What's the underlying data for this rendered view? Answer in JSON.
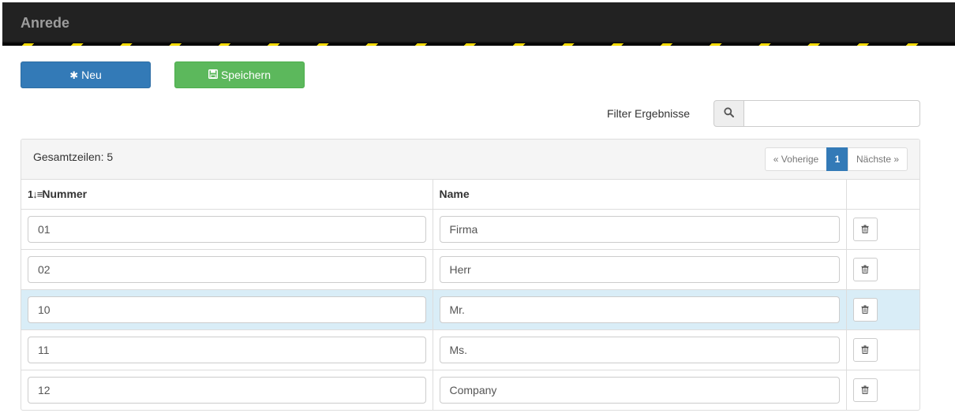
{
  "header": {
    "title": "Anrede"
  },
  "toolbar": {
    "new_label": "Neu",
    "save_label": "Speichern"
  },
  "filter": {
    "label": "Filter Ergebnisse",
    "value": "",
    "placeholder": ""
  },
  "panel": {
    "total_label": "Gesamtzeilen: 5",
    "pagination": {
      "prev": "« Voherige",
      "current": "1",
      "next": "Nächste »"
    }
  },
  "table": {
    "sort_icon": "1↓≡",
    "headers": [
      "Nummer",
      "Name",
      ""
    ],
    "rows": [
      {
        "nummer": "01",
        "name": "Firma"
      },
      {
        "nummer": "02",
        "name": "Herr"
      },
      {
        "nummer": "10",
        "name": "Mr."
      },
      {
        "nummer": "11",
        "name": "Ms."
      },
      {
        "nummer": "12",
        "name": "Company"
      }
    ]
  },
  "icons": {
    "new": "asterisk-icon",
    "save": "floppy-disk-icon",
    "search": "search-icon",
    "delete": "trash-icon",
    "sort": "sort-numeric-icon"
  },
  "colors": {
    "header_bg": "#222222",
    "hazard_yellow": "#f2d900",
    "primary": "#337ab7",
    "success": "#5cb85c",
    "row_highlight": "#d9edf7"
  }
}
